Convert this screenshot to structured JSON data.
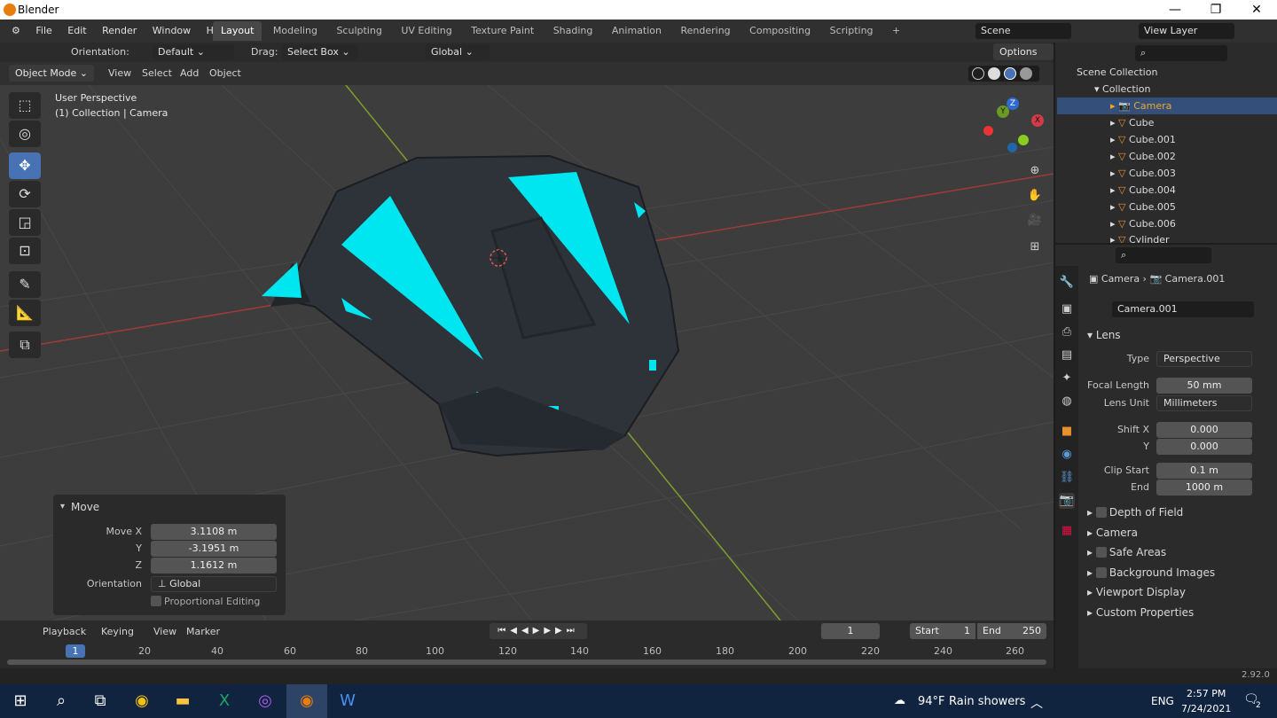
{
  "window": {
    "title": "Blender",
    "minimize": "—",
    "maximize": "❐",
    "close": "✕"
  },
  "menu": [
    "File",
    "Edit",
    "Render",
    "Window",
    "Help"
  ],
  "workspaces": [
    "Layout",
    "Modeling",
    "Sculpting",
    "UV Editing",
    "Texture Paint",
    "Shading",
    "Animation",
    "Rendering",
    "Compositing",
    "Scripting"
  ],
  "active_workspace": "Layout",
  "add_workspace": "+",
  "scene": "Scene",
  "view_layer": "View Layer",
  "tool_header": {
    "orientation_label": "Orientation:",
    "orientation_value": "Default",
    "drag_label": "Drag:",
    "drag_value": "Select Box",
    "transform_space": "Global",
    "options": "Options"
  },
  "viewport_header": {
    "mode": "Object Mode",
    "items": [
      "View",
      "Select",
      "Add",
      "Object"
    ]
  },
  "viewport_info": {
    "line1": "User Perspective",
    "line2": "(1) Collection | Camera"
  },
  "gizmo": {
    "x": "X",
    "y": "Y",
    "z": "Z"
  },
  "move_panel": {
    "title": "Move",
    "move_x_label": "Move X",
    "move_x": "3.1108 m",
    "y_label": "Y",
    "y": "-3.1951 m",
    "z_label": "Z",
    "z": "1.1612 m",
    "orientation_label": "Orientation",
    "orientation": "Global",
    "proportional": "Proportional Editing"
  },
  "outliner": {
    "scene_collection": "Scene Collection",
    "collection": "Collection",
    "items": [
      "Camera",
      "Cube",
      "Cube.001",
      "Cube.002",
      "Cube.003",
      "Cube.004",
      "Cube.005",
      "Cube.006",
      "Cylinder"
    ],
    "selected": "Camera"
  },
  "properties": {
    "breadcrumb_obj": "Camera",
    "breadcrumb_data": "Camera.001",
    "datablock": "Camera.001",
    "lens_title": "Lens",
    "type_label": "Type",
    "type": "Perspective",
    "focal_label": "Focal Length",
    "focal": "50 mm",
    "lens_unit_label": "Lens Unit",
    "lens_unit": "Millimeters",
    "shiftx_label": "Shift X",
    "shiftx": "0.000",
    "shifty_label": "Y",
    "shifty": "0.000",
    "clip_start_label": "Clip Start",
    "clip_start": "0.1 m",
    "clip_end_label": "End",
    "clip_end": "1000 m",
    "sections": [
      "Depth of Field",
      "Camera",
      "Safe Areas",
      "Background Images",
      "Viewport Display",
      "Custom Properties"
    ]
  },
  "timeline": {
    "menus": [
      "Playback",
      "Keying",
      "View",
      "Marker"
    ],
    "current_frame": "1",
    "start_label": "Start",
    "start": "1",
    "end_label": "End",
    "end": "250",
    "ticks": [
      "1",
      "20",
      "40",
      "60",
      "80",
      "100",
      "120",
      "140",
      "160",
      "180",
      "200",
      "220",
      "240",
      "260"
    ]
  },
  "status": {
    "version": "2.92.0"
  },
  "taskbar": {
    "weather_temp": "94°F",
    "weather_text": "Rain showers",
    "lang": "ENG",
    "time": "2:57 PM",
    "date": "7/24/2021",
    "notif": "2"
  },
  "colors": {
    "accent": "#4772b3",
    "glow": "#00e6f0",
    "selected_row": "#344f7a",
    "camera_name": "#f5a623"
  }
}
